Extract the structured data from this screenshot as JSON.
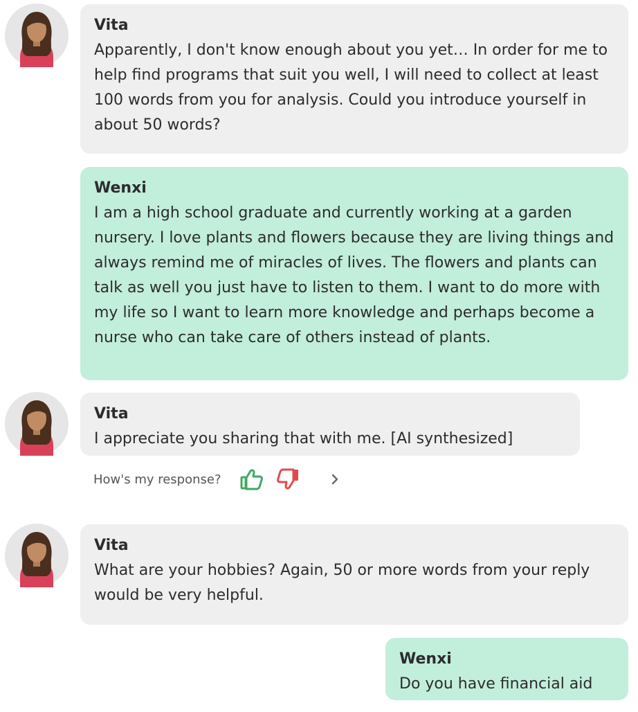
{
  "colors": {
    "bot_bubble": "#efefef",
    "user_bubble": "#c2eedc",
    "thumbs_up": "#3daa63",
    "thumbs_down": "#e24a4a"
  },
  "messages": [
    {
      "role": "bot",
      "sender": "Vita",
      "text": "Apparently, I don't know enough about you yet… In order for me to help find programs that suit you well, I will need to collect at least 100 words from you for analysis. Could you introduce yourself in about 50 words?"
    },
    {
      "role": "user",
      "sender": "Wenxi",
      "text": "I am a high school graduate and currently working at a garden nursery. I love plants and flowers because they are living things and always remind me of miracles of lives. The flowers and plants can talk as well you just have to listen to them. I want to do more with my life so I want to learn more knowledge and perhaps become a nurse who can take care of others instead of plants."
    },
    {
      "role": "bot",
      "sender": "Vita",
      "text": "I appreciate you sharing that with me. [AI synthesized]"
    },
    {
      "role": "bot",
      "sender": "Vita",
      "text": "What are your hobbies? Again, 50 or more words from your reply would be very helpful."
    },
    {
      "role": "user",
      "sender": "Wenxi",
      "text": "Do you have financial aid"
    }
  ],
  "feedback": {
    "label": "How's my response?",
    "thumbs_up_icon": "thumbs-up-icon",
    "thumbs_down_icon": "thumbs-down-icon",
    "more_icon": "chevron-right-icon"
  }
}
